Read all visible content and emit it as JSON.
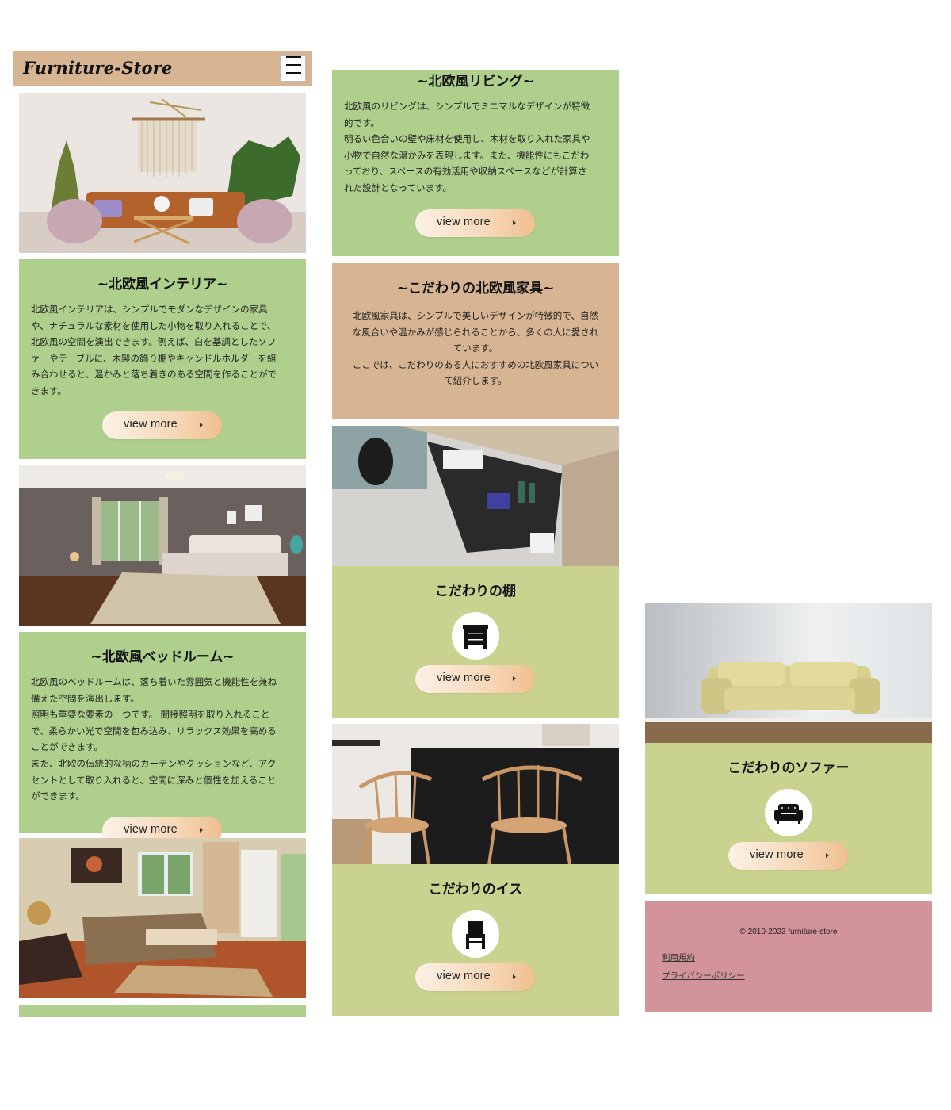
{
  "header": {
    "logo": "Furniture-Store",
    "menu_icon": "hamburger-menu-icon"
  },
  "col1": {
    "interior": {
      "title": "~北欧風インテリア~",
      "body": [
        "北欧風インテリアは、シンプルでモダンなデザインの家具",
        "や、ナチュラルな素材を使用した小物を取り入れることで、",
        "北欧風の空間を演出できます。例えば、白を基調としたソフ",
        "ァーやテーブルに、木製の飾り棚やキャンドルホルダーを組",
        "み合わせると、温かみと落ち着きのある空間を作ることがで",
        "きます。"
      ],
      "button": "view more"
    },
    "bedroom": {
      "title": "~北欧風ベッドルーム~",
      "body": [
        "北欧風のベッドルームは、落ち着いた雰囲気と機能性を兼ね",
        "備えた空間を演出します。",
        "照明も重要な要素の一つです。 間接照明を取り入れること",
        "で、柔らかい光で空間を包み込み、リラックス効果を高める",
        "ことができます。",
        "また、北欧の伝統的な柄のカーテンやクッションなど、アク",
        "セントとして取り入れると、空間に深みと個性を加えること",
        "ができます。"
      ],
      "button": "view more"
    }
  },
  "col2": {
    "living": {
      "title": "~北欧風リビング~",
      "body": [
        "北欧風のリビングは、シンプルでミニマルなデザインが特徴",
        "的です。",
        "明るい色合いの壁や床材を使用し、木材を取り入れた家具や",
        "小物で自然な温かみを表現します。また、機能性にもこだわ",
        "っており、スペースの有効活用や収納スペースなどが計算さ",
        "れた設計となっています。"
      ],
      "button": "view more"
    },
    "furniture": {
      "title": "~こだわりの北欧風家具~",
      "body": [
        "北欧風家具は、シンプルで美しいデザインが特徴的で、自然",
        "な風合いや温かみが感じられることから、多くの人に愛され",
        "ています。",
        "ここでは、こだわりのある人におすすめの北欧風家具につい",
        "て紹介します。"
      ]
    },
    "shelf": {
      "title": "こだわりの棚",
      "icon": "cabinet-icon",
      "button": "view more"
    },
    "chair": {
      "title": "こだわりのイス",
      "icon": "chair-icon",
      "button": "view more"
    }
  },
  "col3": {
    "sofa": {
      "title": "こだわりのソファー",
      "icon": "sofa-icon",
      "button": "view more"
    },
    "footer": {
      "copyright": "© 2010-2023 furniture-store",
      "links": [
        "利用規約",
        "プライバシーポリシー"
      ]
    }
  },
  "colors": {
    "green": "#afcf8d",
    "tan": "#d7b593",
    "olive": "#c9d38f",
    "pink": "#d3939a"
  }
}
